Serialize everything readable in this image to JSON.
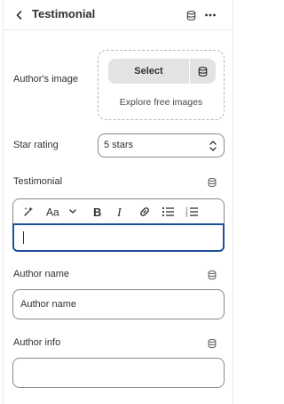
{
  "header": {
    "title": "Testimonial"
  },
  "author_image": {
    "label": "Author's image",
    "select_label": "Select",
    "explore_label": "Explore free images"
  },
  "star_rating": {
    "label": "Star rating",
    "value": "5 stars"
  },
  "testimonial": {
    "label": "Testimonial",
    "value": ""
  },
  "author_name": {
    "label": "Author name",
    "value": "Author name"
  },
  "author_info": {
    "label": "Author info",
    "value": ""
  },
  "colors": {
    "focus_border": "#1f5199",
    "input_border": "#8a8a8a",
    "button_bg": "#e3e3e3"
  },
  "icons": [
    "chevron-left-icon",
    "database-icon",
    "more-horizontal-icon",
    "magic-icon",
    "font-icon",
    "bold-icon",
    "italic-icon",
    "link-icon",
    "bullet-list-icon",
    "numbered-list-icon",
    "select-chevron-icon"
  ]
}
